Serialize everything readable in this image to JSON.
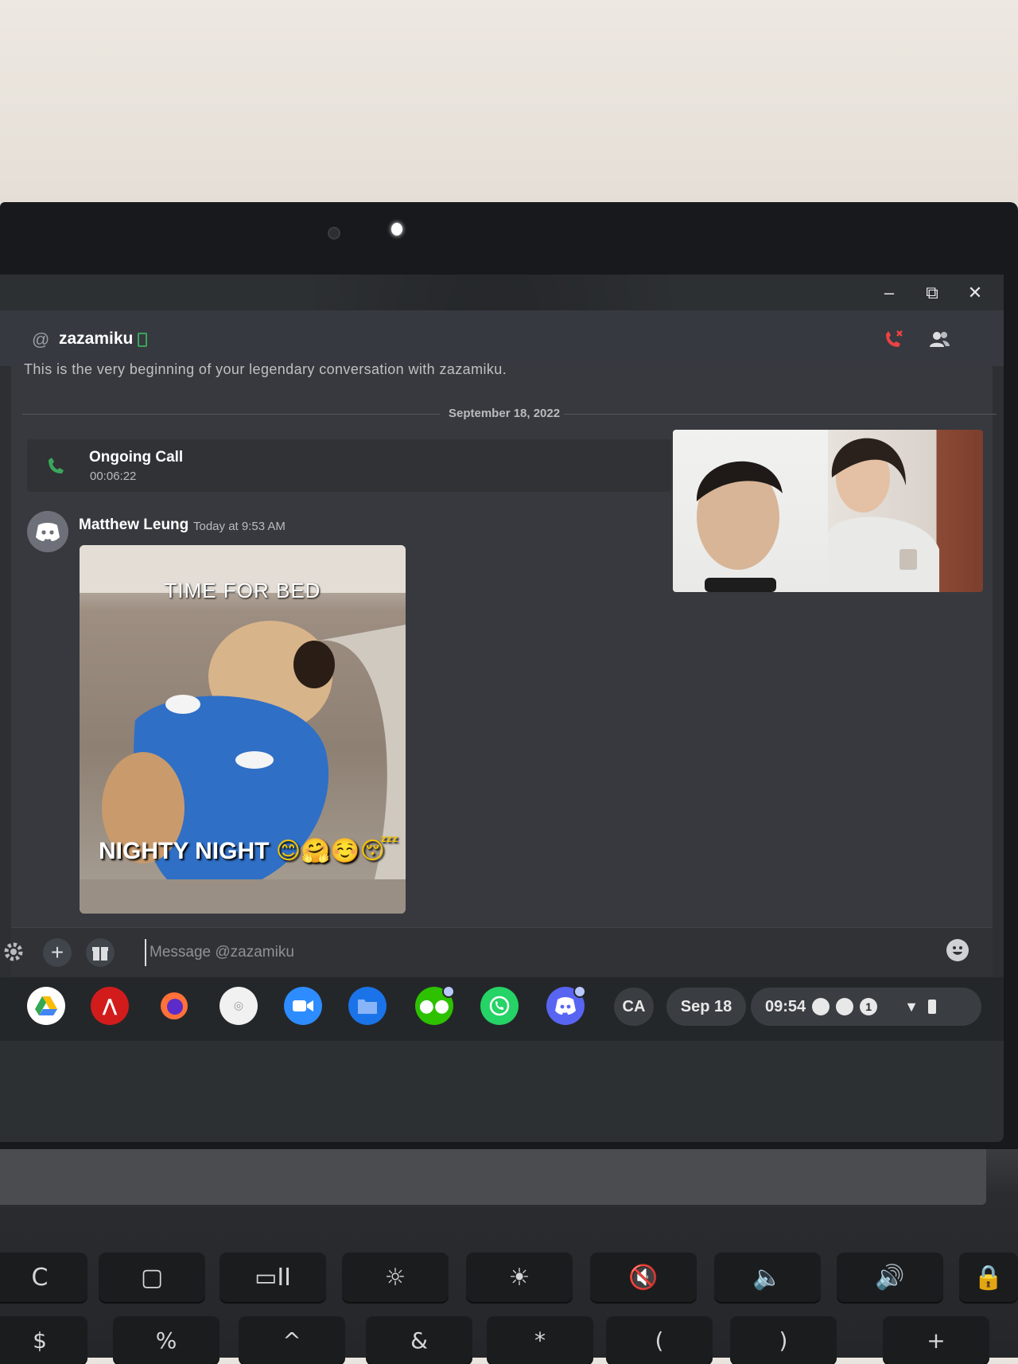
{
  "window": {
    "minimize_label": "–",
    "restore_label": "⧉",
    "close_label": "✕"
  },
  "header": {
    "at_symbol": "@",
    "username": "zazamiku",
    "status_icon": "mobile-online-icon",
    "actions": [
      "hang-up-icon",
      "member-list-icon"
    ]
  },
  "chat": {
    "intro_text": "This is the very beginning of your legendary conversation with zazamiku.",
    "date_divider": "September 18, 2022",
    "call": {
      "title": "Ongoing Call",
      "duration": "00:06:22"
    },
    "message": {
      "author": "Matthew Leung",
      "timestamp": "Today at 9:53 AM",
      "gif_top_text": "TIME FOR BED",
      "gif_bottom_text": "NIGHTY NIGHT",
      "gif_emojis": "😊🤗☺️😴"
    }
  },
  "composer": {
    "placeholder": "Message @zazamiku"
  },
  "shelf": {
    "apps": [
      "google-drive-icon",
      "acrobat-icon",
      "firefox-icon",
      "app-icon",
      "zoom-icon",
      "files-icon",
      "wechat-icon",
      "whatsapp-icon",
      "discord-icon"
    ],
    "ime": "CA",
    "date": "Sep 18",
    "time": "09:54",
    "notification_count": "1"
  },
  "keyboard": {
    "row1": [
      "C",
      "▢",
      "▭II",
      "☼",
      "☀",
      "🔇",
      "🔈",
      "🔊",
      "🔒"
    ],
    "row2": [
      "$",
      "%",
      "^",
      "?",
      "&",
      "*",
      "(",
      ")",
      "+"
    ]
  },
  "colors": {
    "discord_bg": "#36393f",
    "call_green": "#3ba55c",
    "hangup_red": "#ed4245",
    "discord_blurple": "#5865f2"
  }
}
